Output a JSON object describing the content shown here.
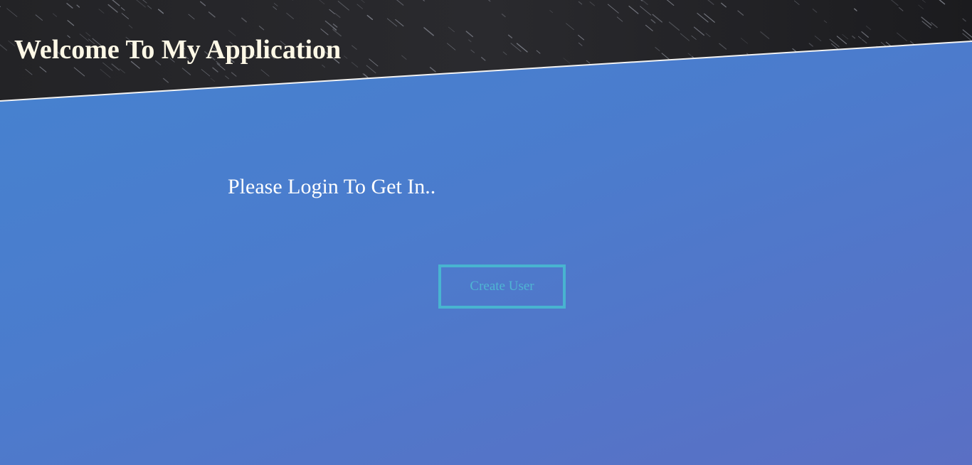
{
  "header": {
    "title": "Welcome To My Application"
  },
  "main": {
    "prompt": "Please Login To Get In..",
    "create_user_label": "Create User"
  },
  "colors": {
    "header_background": "#1c1c1f",
    "body_gradient_start": "#4583d0",
    "body_gradient_end": "#5a6fc4",
    "title_text": "#fdf8e6",
    "button_border": "#48b4d0",
    "button_text": "#4fb5d3"
  }
}
